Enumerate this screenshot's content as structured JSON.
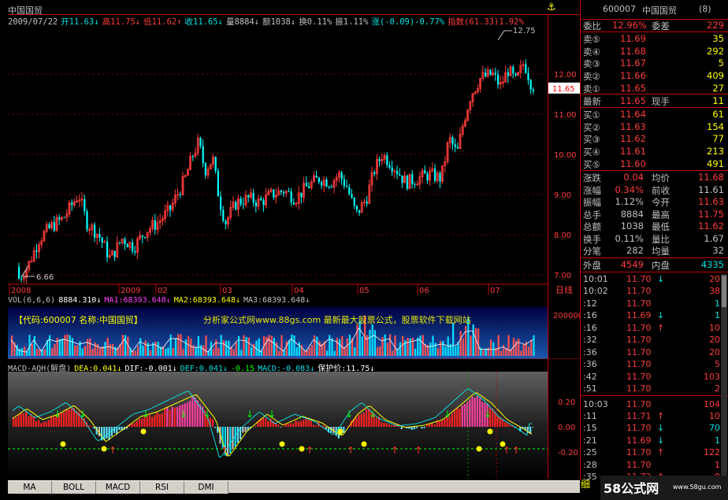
{
  "header": {
    "stock_name": "中国国贸",
    "stats": [
      {
        "text": "2009/07/22",
        "color": "#c0c0c0"
      },
      {
        "text": "开11.63↓",
        "color": "#00e0e0"
      },
      {
        "text": "高11.75↓",
        "color": "#ff3c3c"
      },
      {
        "text": "低11.62↑",
        "color": "#ff3c3c"
      },
      {
        "text": "收11.65↓",
        "color": "#00e0e0"
      },
      {
        "text": "量8884↓",
        "color": "#c0c0c0"
      },
      {
        "text": "额1038↓",
        "color": "#c0c0c0"
      },
      {
        "text": "换0.11%",
        "color": "#c0c0c0"
      },
      {
        "text": "振1.11%",
        "color": "#c0c0c0"
      },
      {
        "text": "涨(-0.09)-0.77%",
        "color": "#00e0e0"
      },
      {
        "text": "指数(61.33)1.92%",
        "color": "#ff3c3c"
      }
    ],
    "anchor_icon": "anchor-icon"
  },
  "price_chart": {
    "high_label": "12.75",
    "low_label": "6.66",
    "current_price": "11.65",
    "y_ticks": [
      "12.00",
      "11.00",
      "10.00",
      "9.00",
      "8.00",
      "7.00"
    ],
    "x_ticks": [
      "2008",
      "2009",
      "02",
      "03",
      "04",
      "05",
      "06",
      "07"
    ],
    "period_label": "日线"
  },
  "volume": {
    "indicators": [
      {
        "text": "VOL(6,6,6)",
        "color": "#c0c0c0"
      },
      {
        "text": "8884.310↓",
        "color": "#ffffff"
      },
      {
        "text": "MA1:68393.648↓",
        "color": "#ff40ff"
      },
      {
        "text": "MA2:68393.648↓",
        "color": "#ffff00"
      },
      {
        "text": "MA3:68393.648↓",
        "color": "#c0c0c0"
      }
    ],
    "code_banner": "【代码:600007 名称:中国国贸】",
    "watermark": "分析家公式网www.88gs.com 最新最大股票公式，股票软件下载网站",
    "y_tick": "200000"
  },
  "macd": {
    "indicators": [
      {
        "text": "MACD-AQH(解盘)",
        "color": "#c0c0c0"
      },
      {
        "text": "DEA:0.041↓",
        "color": "#ffff00"
      },
      {
        "text": "DIF:-0.001↓",
        "color": "#ffffff"
      },
      {
        "text": "DEF:0.041↓",
        "color": "#00e0e0"
      },
      {
        "text": "-0.15",
        "color": "#00ff00"
      },
      {
        "text": "MACD:-0.083↓",
        "color": "#00e0e0"
      },
      {
        "text": "保护价:11.75↓",
        "color": "#ffffff"
      }
    ],
    "y_ticks": [
      "0.20",
      "0.00",
      "-0.20"
    ]
  },
  "tabs": [
    "MA",
    "BOLL",
    "MACD",
    "RSI",
    "DMI"
  ],
  "quote": {
    "code": "600007",
    "name": "中国国贸",
    "count": "(8)",
    "weibi": {
      "label": "委比",
      "value": "12.96%",
      "label2": "委差",
      "value2": "229"
    },
    "sell": [
      {
        "label": "卖⑤",
        "price": "11.69",
        "vol": "35"
      },
      {
        "label": "卖④",
        "price": "11.68",
        "vol": "292"
      },
      {
        "label": "卖③",
        "price": "11.67",
        "vol": "5"
      },
      {
        "label": "卖②",
        "price": "11.66",
        "vol": "409"
      },
      {
        "label": "卖①",
        "price": "11.65",
        "vol": "27"
      }
    ],
    "latest": {
      "label": "最新",
      "price": "11.65",
      "label2": "现手",
      "value2": "11"
    },
    "buy": [
      {
        "label": "买①",
        "price": "11.64",
        "vol": "61"
      },
      {
        "label": "买②",
        "price": "11.63",
        "vol": "154"
      },
      {
        "label": "买③",
        "price": "11.62",
        "vol": "77"
      },
      {
        "label": "买④",
        "price": "11.61",
        "vol": "213"
      },
      {
        "label": "买⑤",
        "price": "11.60",
        "vol": "491"
      }
    ],
    "stats": [
      {
        "l1": "涨跌",
        "v1": "0.04",
        "c1": "#ff3c3c",
        "l2": "均价",
        "v2": "11.68",
        "c2": "#ff3c3c"
      },
      {
        "l1": "涨幅",
        "v1": "0.34%",
        "c1": "#ff3c3c",
        "l2": "前收",
        "v2": "11.61",
        "c2": "#c0c0c0"
      },
      {
        "l1": "振幅",
        "v1": "1.12%",
        "c1": "#c0c0c0",
        "l2": "今开",
        "v2": "11.63",
        "c2": "#ff3c3c"
      },
      {
        "l1": "总手",
        "v1": "8884",
        "c1": "#c0c0c0",
        "l2": "最高",
        "v2": "11.75",
        "c2": "#ff3c3c"
      },
      {
        "l1": "总额",
        "v1": "1038",
        "c1": "#c0c0c0",
        "l2": "最低",
        "v2": "11.62",
        "c2": "#ff3c3c"
      },
      {
        "l1": "换手",
        "v1": "0.11%",
        "c1": "#c0c0c0",
        "l2": "量比",
        "v2": "1.67",
        "c2": "#c0c0c0"
      },
      {
        "l1": "分笔",
        "v1": "282",
        "c1": "#c0c0c0",
        "l2": "均量",
        "v2": "32",
        "c2": "#c0c0c0"
      }
    ],
    "outer": {
      "label": "外盘",
      "value": "4549",
      "label2": "内盘",
      "value2": "4335"
    },
    "ticks": [
      {
        "time": "10:01",
        "price": "11.70",
        "arrow": "↓",
        "vol": "20",
        "ac": "#00e0e0",
        "vc": "#ff3c3c"
      },
      {
        "time": "10:02",
        "price": "11.70",
        "arrow": "",
        "vol": "38",
        "ac": "#ff3c3c",
        "vc": "#ff3c3c"
      },
      {
        "time": ":12",
        "price": "11.70",
        "arrow": "",
        "vol": "1",
        "ac": "#ff3c3c",
        "vc": "#00e0e0"
      },
      {
        "time": ":16",
        "price": "11.69",
        "arrow": "↓",
        "vol": "1",
        "ac": "#00e0e0",
        "vc": "#00e0e0"
      },
      {
        "time": ":16",
        "price": "11.70",
        "arrow": "↑",
        "vol": "10",
        "ac": "#ff3c3c",
        "vc": "#ff3c3c"
      },
      {
        "time": ":32",
        "price": "11.70",
        "arrow": "",
        "vol": "20",
        "ac": "#ff3c3c",
        "vc": "#ff3c3c"
      },
      {
        "time": ":36",
        "price": "11.70",
        "arrow": "",
        "vol": "20",
        "ac": "#ff3c3c",
        "vc": "#ff3c3c"
      },
      {
        "time": ":36",
        "price": "11.70",
        "arrow": "",
        "vol": "5",
        "ac": "#ff3c3c",
        "vc": "#ff3c3c"
      },
      {
        "time": ":42",
        "price": "11.70",
        "arrow": "",
        "vol": "103",
        "ac": "#ff3c3c",
        "vc": "#ff3c3c"
      },
      {
        "time": ":51",
        "price": "11.70",
        "arrow": "",
        "vol": "2",
        "ac": "#ff3c3c",
        "vc": "#ff3c3c"
      },
      {
        "time": "10:03",
        "price": "11.70",
        "arrow": "",
        "vol": "104",
        "ac": "#ff3c3c",
        "vc": "#ff3c3c"
      },
      {
        "time": ":11",
        "price": "11.71",
        "arrow": "↑",
        "vol": "10",
        "ac": "#ff3c3c",
        "vc": "#ff3c3c"
      },
      {
        "time": ":15",
        "price": "11.70",
        "arrow": "↓",
        "vol": "70",
        "ac": "#00e0e0",
        "vc": "#00e0e0"
      },
      {
        "time": ":21",
        "price": "11.69",
        "arrow": "↓",
        "vol": "1",
        "ac": "#00e0e0",
        "vc": "#00e0e0"
      },
      {
        "time": ":25",
        "price": "11.70",
        "arrow": "↑",
        "vol": "122",
        "ac": "#ff3c3c",
        "vc": "#ff3c3c"
      },
      {
        "time": ":28",
        "price": "11.70",
        "arrow": "",
        "vol": "1",
        "ac": "#ff3c3c",
        "vc": "#ff3c3c"
      },
      {
        "time": ":35",
        "price": "11.72",
        "arrow": "↑",
        "vol": "8",
        "ac": "#ff3c3c",
        "vc": "#ff3c3c"
      }
    ],
    "detail_tab": "细"
  },
  "logo": {
    "big": "58公式网",
    "small": "www.58gu.com"
  }
}
